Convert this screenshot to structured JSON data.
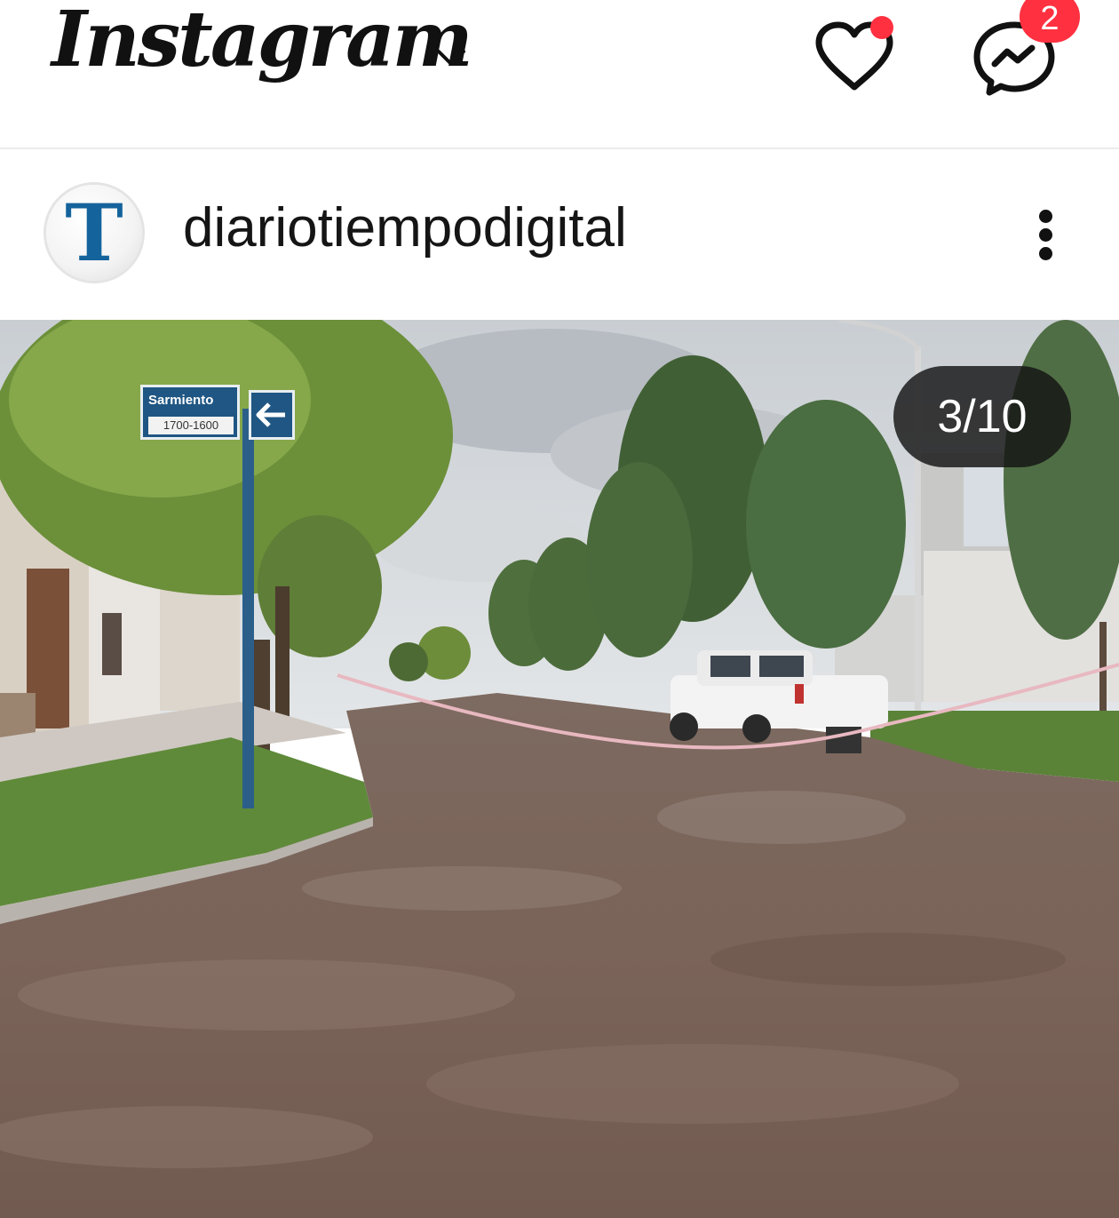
{
  "app": {
    "title": "Instagram",
    "notification_count": "2"
  },
  "icons": {
    "chevron": "chevron-down-icon",
    "heart": "heart-icon",
    "messenger": "messenger-icon",
    "more": "more-vertical-icon"
  },
  "colors": {
    "badge": "#ff3040",
    "avatar_letter": "#15639c"
  },
  "post": {
    "avatar_letter": "T",
    "username": "diariotiempodigital",
    "media": {
      "counter": "3/10",
      "street_sign": {
        "name": "Sarmiento",
        "range": "1700-1600"
      }
    }
  }
}
